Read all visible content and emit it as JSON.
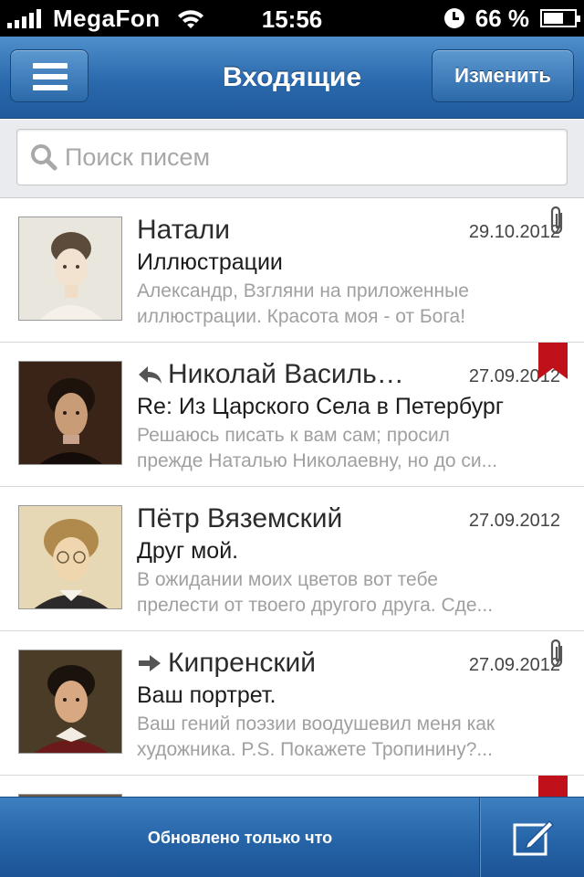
{
  "status_bar": {
    "carrier": "MegaFon",
    "time": "15:56",
    "battery_percent": "66 %",
    "battery_level": 0.66
  },
  "nav": {
    "title": "Входящие",
    "edit_label": "Изменить"
  },
  "search": {
    "placeholder": "Поиск писем"
  },
  "messages": [
    {
      "sender": "Натали",
      "date": "29.10.2012",
      "subject": "Иллюстрации",
      "preview_line1": "Александр, Взгляни на приложенные",
      "preview_line2": "иллюстрации. Красота моя - от Бога!",
      "status_icon": "none",
      "marker_icon": "paperclip-icon"
    },
    {
      "sender": "Николай Васильевич Гоголь",
      "sender_display": "Николай Василь…",
      "date": "27.09.2012",
      "subject": "Re: Из Царского Села в Петербург",
      "preview_line1": "Решаюсь писать к вам сам; просил",
      "preview_line2": "прежде Наталью Николаевну, но до си...",
      "status_icon": "reply-arrow-icon",
      "marker_icon": "flag-icon"
    },
    {
      "sender": "Пётр Вяземский",
      "date": "27.09.2012",
      "subject": "Друг мой.",
      "preview_line1": "В ожидании моих цветов вот тебе",
      "preview_line2": "прелести от твоего другого друга. Сде...",
      "status_icon": "none",
      "marker_icon": "none"
    },
    {
      "sender": "Кипренский",
      "date": "27.09.2012",
      "subject": "Ваш портрет.",
      "preview_line1": "Ваш гений поэзии воодушевил меня как",
      "preview_line2": "художника. P.S.  Покажете Тропинину?...",
      "status_icon": "forward-arrow-icon",
      "marker_icon": "paperclip-icon"
    }
  ],
  "toolbar": {
    "status_text": "Обновлено только что"
  },
  "colors": {
    "nav_blue": "#2a69ad",
    "flag_red": "#c0101a",
    "preview_gray": "#a0a0a0"
  }
}
